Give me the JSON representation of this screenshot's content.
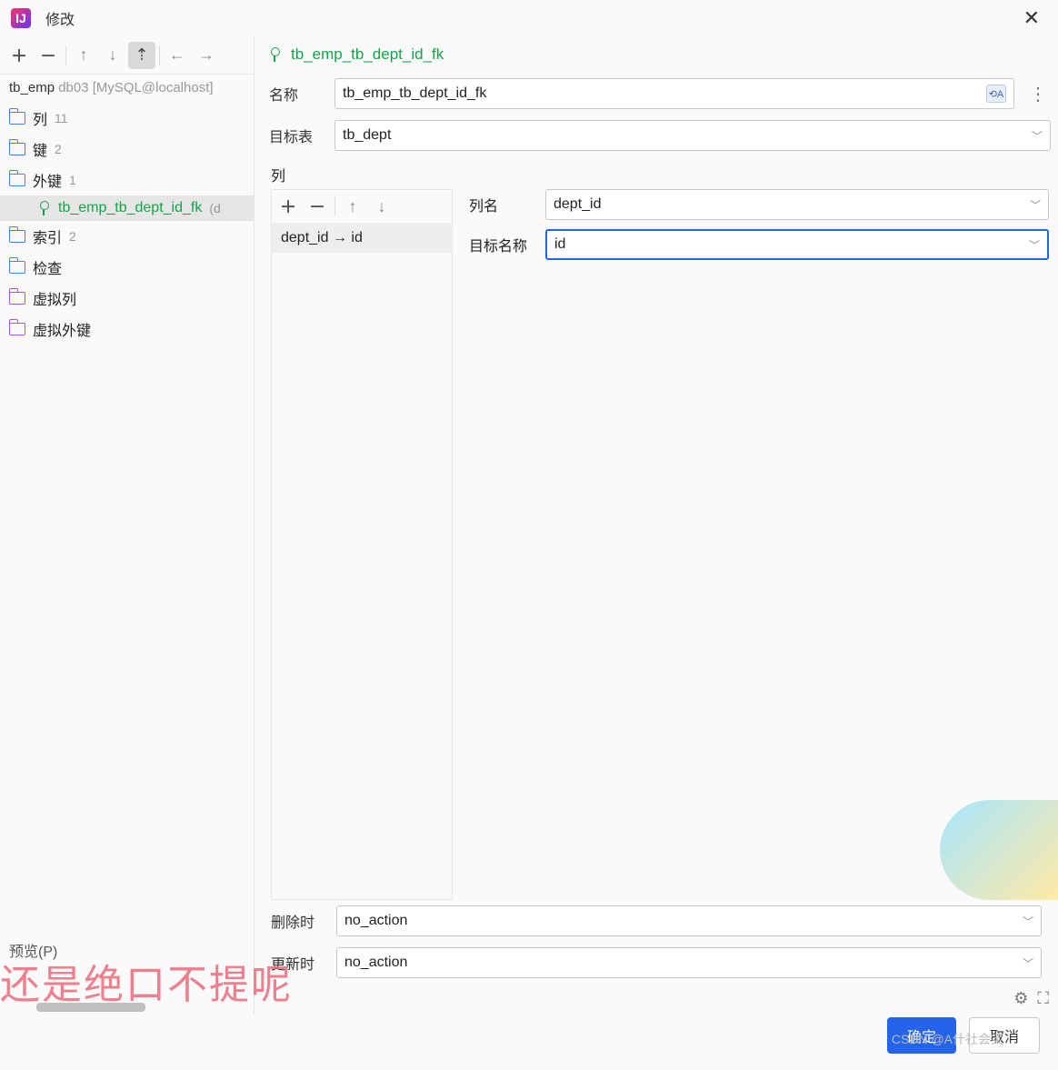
{
  "window": {
    "title": "修改",
    "close_glyph": "✕"
  },
  "left": {
    "toolbar": {
      "add": "＋",
      "remove": "－",
      "up": "↑",
      "down": "↓",
      "top": "⇡",
      "back": "←",
      "forward": "→"
    },
    "breadcrumb": {
      "table": "tb_emp",
      "conn": "db03 [MySQL@localhost]"
    },
    "tree": {
      "columns": {
        "label": "列",
        "count": "11"
      },
      "keys": {
        "label": "键",
        "count": "2"
      },
      "fkeys": {
        "label": "外键",
        "count": "1"
      },
      "fk_item": {
        "name": "tb_emp_tb_dept_id_fk",
        "suffix": "(d"
      },
      "indexes": {
        "label": "索引",
        "count": "2"
      },
      "checks": {
        "label": "检查"
      },
      "vcols": {
        "label": "虚拟列"
      },
      "vfk": {
        "label": "虚拟外键"
      }
    }
  },
  "right": {
    "header_name": "tb_emp_tb_dept_id_fk",
    "name_label": "名称",
    "name_value": "tb_emp_tb_dept_id_fk",
    "target_table_label": "目标表",
    "target_table_value": "tb_dept",
    "cols_section": "列",
    "cols_toolbar": {
      "add": "＋",
      "remove": "－",
      "up": "↑",
      "down": "↓"
    },
    "col_mapping": "dept_id → id",
    "col_name_label": "列名",
    "col_name_value": "dept_id",
    "target_name_label": "目标名称",
    "target_name_value": "id",
    "on_delete_label": "删除时",
    "on_delete_value": "no_action",
    "on_update_label": "更新时",
    "on_update_value": "no_action",
    "badge": "⟲A"
  },
  "footer": {
    "preview": "预览(P)",
    "ok": "确定",
    "cancel": "取消"
  },
  "watermark": {
    "w1": "还是绝口不提呢",
    "w2": "CSDN @A什社会笑"
  }
}
